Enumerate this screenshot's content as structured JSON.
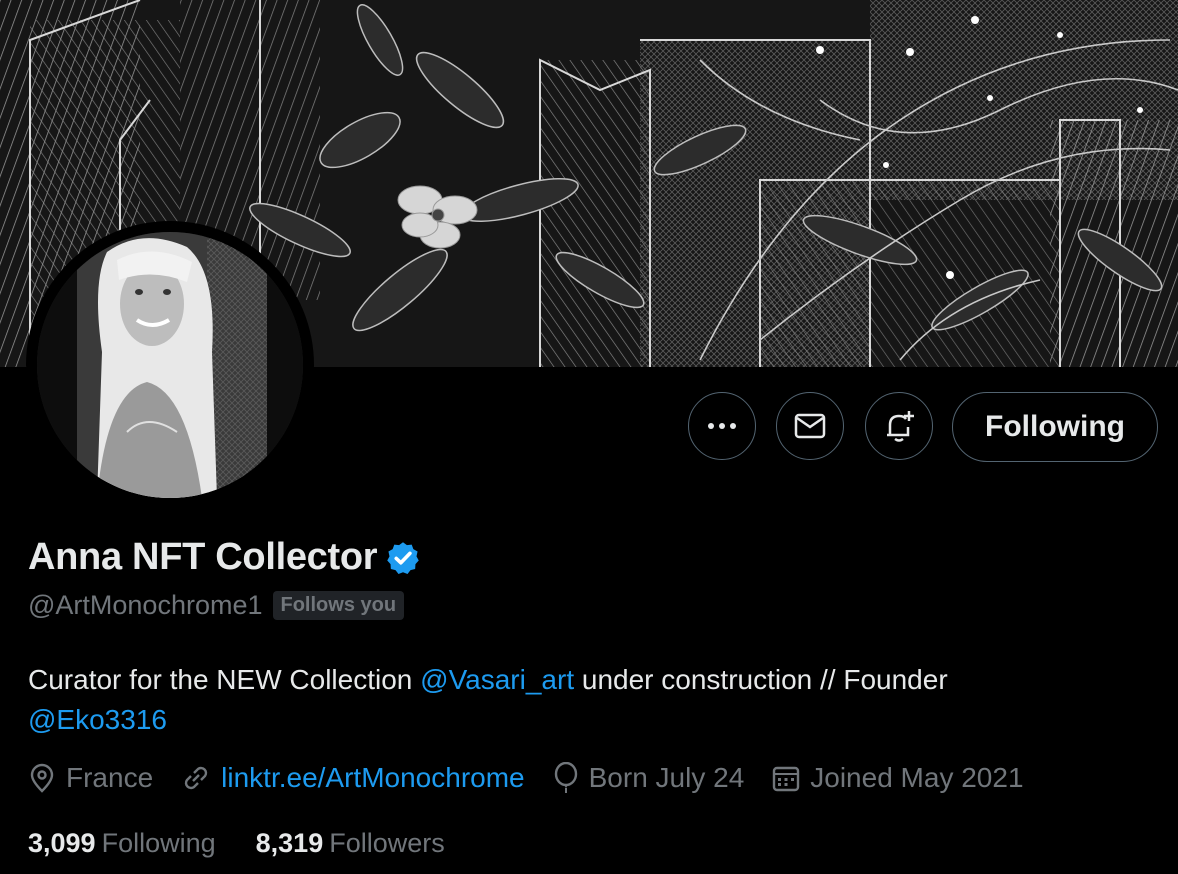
{
  "profile": {
    "name": "Anna NFT Collector",
    "handle": "@ArtMonochrome1",
    "follows_you": "Follows you",
    "bio_prefix": "Curator for the NEW Collection ",
    "bio_mention_1": "@Vasari_art",
    "bio_middle": " under construction // Founder",
    "bio_mention_2": "@Eko3316",
    "location": "France",
    "website": "linktr.ee/ArtMonochrome",
    "birthday": "Born July 24",
    "joined": "Joined May 2021",
    "following_count": "3,099",
    "following_label": "Following",
    "followers_count": "8,319",
    "followers_label": "Followers"
  },
  "actions": {
    "more_icon": "more-icon",
    "message_icon": "envelope-icon",
    "notify_icon": "bell-plus-icon",
    "follow_label": "Following"
  },
  "colors": {
    "background": "#000000",
    "text": "#e7e9ea",
    "muted": "#71767b",
    "link": "#1d9bf0",
    "verified": "#1d9bf0",
    "border": "#536471"
  }
}
